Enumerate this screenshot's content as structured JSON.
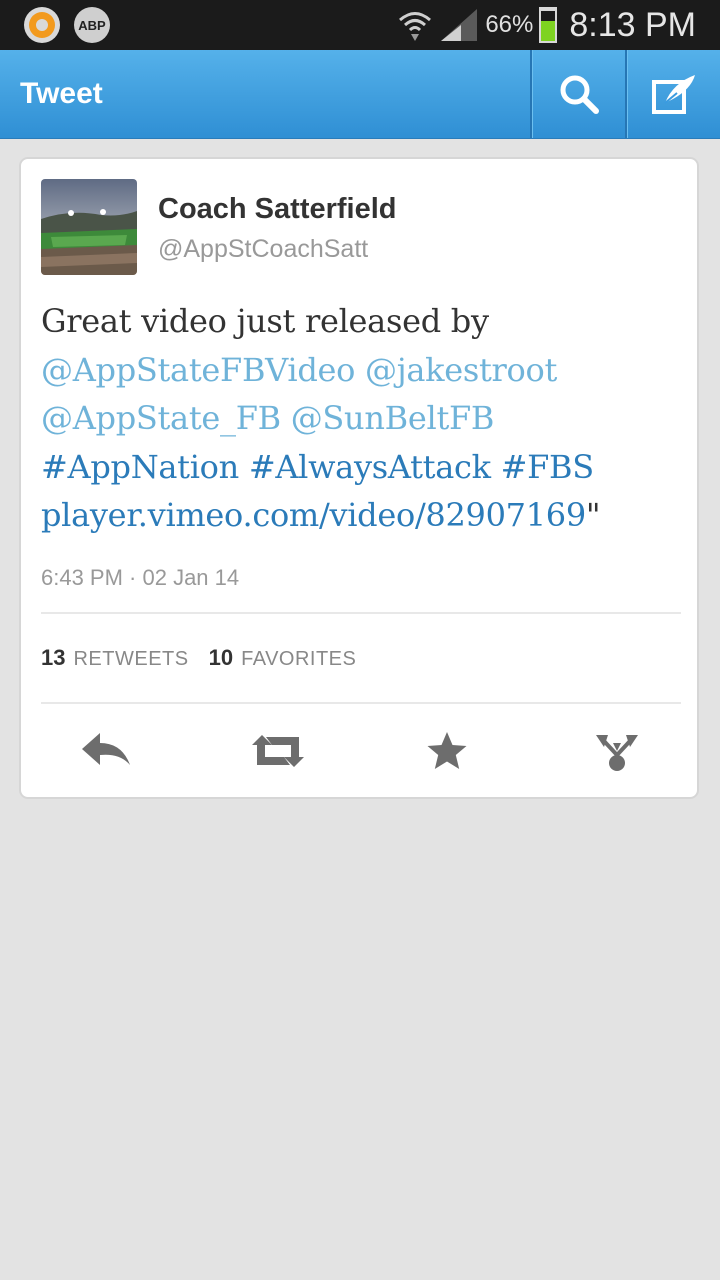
{
  "status_bar": {
    "battery_percent": "66%",
    "battery_level": 0.66,
    "time": "8:13 PM",
    "abp_label": "ABP",
    "accent_color": "#f29a1e",
    "battery_color": "#7ed321"
  },
  "action_bar": {
    "title": "Tweet",
    "search_icon": "search-icon",
    "compose_icon": "compose-icon"
  },
  "tweet": {
    "name": "Coach Satterfield",
    "handle": "@AppStCoachSatt",
    "text_prefix": "Great video just released by",
    "mention_1": "@AppStateFBVideo",
    "mention_2": "@jakestroot",
    "mention_3": "@AppState_FB",
    "mention_4": "@SunBeltFB",
    "hashtag_1": "#AppNation",
    "hashtag_2": "#AlwaysAttack",
    "hashtag_3": "#FBS",
    "link": "player.vimeo.com/video/82907169",
    "closing_quote": "\"",
    "timestamp": "6:43 PM · 02 Jan 14",
    "retweets_count": "13",
    "retweets_label": "RETWEETS",
    "favorites_count": "10",
    "favorites_label": "FAVORITES",
    "link_color": "#2b7bb9",
    "mention_color": "#6fb3d9"
  },
  "actions": [
    "reply-icon",
    "retweet-icon",
    "favorite-icon",
    "share-icon"
  ]
}
